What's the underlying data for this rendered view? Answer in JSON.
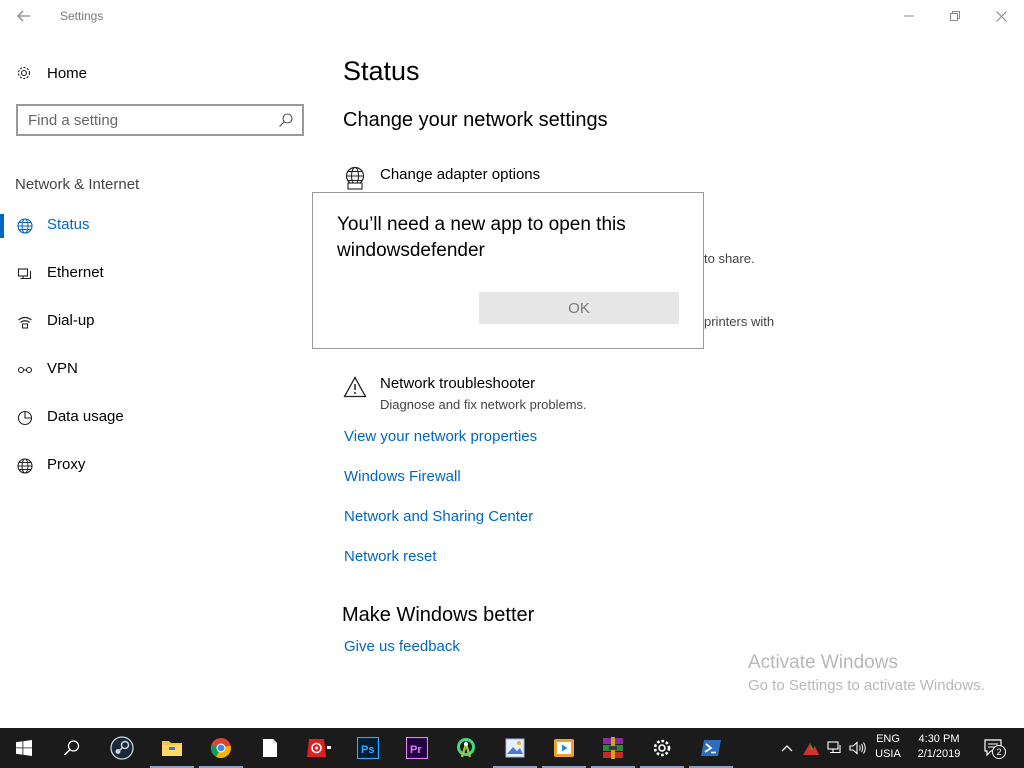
{
  "window": {
    "title": "Settings",
    "back_icon": "back-arrow-icon",
    "minimize_icon": "minimize-icon",
    "maximize_icon": "restore-icon",
    "close_icon": "close-icon"
  },
  "sidebar": {
    "home_label": "Home",
    "search_placeholder": "Find a setting",
    "section_label": "Network & Internet",
    "items": [
      {
        "label": "Status",
        "icon": "globe-icon",
        "active": true
      },
      {
        "label": "Ethernet",
        "icon": "ethernet-icon",
        "active": false
      },
      {
        "label": "Dial-up",
        "icon": "dialup-icon",
        "active": false
      },
      {
        "label": "VPN",
        "icon": "vpn-icon",
        "active": false
      },
      {
        "label": "Data usage",
        "icon": "data-usage-icon",
        "active": false
      },
      {
        "label": "Proxy",
        "icon": "proxy-globe-icon",
        "active": false
      }
    ]
  },
  "main": {
    "page_title": "Status",
    "subtitle": "Change your network settings",
    "settings": [
      {
        "title": "Change adapter options",
        "icon": "adapter-globe-icon",
        "description": ""
      },
      {
        "title": "Network troubleshooter",
        "icon": "warning-icon",
        "description": "Diagnose and fix network problems."
      }
    ],
    "partial_texts": [
      "to share.",
      "printers with"
    ],
    "links": [
      "View your network properties",
      "Windows Firewall",
      "Network and Sharing Center",
      "Network reset"
    ],
    "section2_title": "Make Windows better",
    "feedback_link": "Give us feedback"
  },
  "dialog": {
    "message": "You’ll need a new app to open this windowsdefender",
    "ok_label": "OK"
  },
  "watermark": {
    "line1": "Activate Windows",
    "line2": "Go to Settings to activate Windows."
  },
  "taskbar": {
    "apps": [
      {
        "name": "start-button",
        "icon": "windows-logo-icon"
      },
      {
        "name": "search-button",
        "icon": "search-icon"
      },
      {
        "name": "steam",
        "icon": "steam-icon"
      },
      {
        "name": "file-explorer",
        "icon": "folder-icon"
      },
      {
        "name": "chrome",
        "icon": "chrome-icon"
      },
      {
        "name": "document",
        "icon": "document-icon"
      },
      {
        "name": "app-red",
        "icon": "red-app-icon"
      },
      {
        "name": "photoshop",
        "icon": "photoshop-icon"
      },
      {
        "name": "premiere",
        "icon": "premiere-icon"
      },
      {
        "name": "android-studio",
        "icon": "android-studio-icon"
      },
      {
        "name": "image-viewer",
        "icon": "image-icon"
      },
      {
        "name": "media-player",
        "icon": "media-player-icon"
      },
      {
        "name": "winrar",
        "icon": "winrar-icon"
      },
      {
        "name": "settings",
        "icon": "gear-icon"
      },
      {
        "name": "powershell",
        "icon": "powershell-icon"
      }
    ],
    "lang_line1": "ENG",
    "lang_line2": "USIA",
    "time": "4:30 PM",
    "date": "2/1/2019",
    "notification_count": "2"
  }
}
